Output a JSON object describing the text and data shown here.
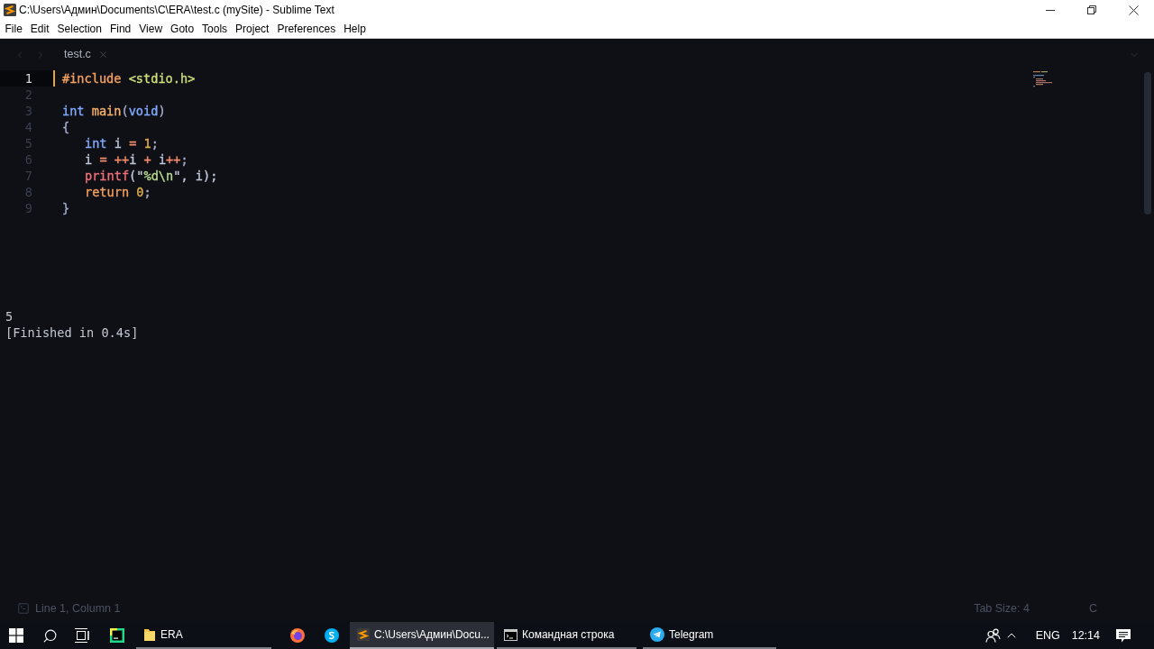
{
  "window": {
    "title": "C:\\Users\\Админ\\Documents\\C\\ERA\\test.c (mySite) - Sublime Text"
  },
  "menu": [
    "File",
    "Edit",
    "Selection",
    "Find",
    "View",
    "Goto",
    "Tools",
    "Project",
    "Preferences",
    "Help"
  ],
  "tabs": [
    {
      "label": "test.c",
      "selected": true
    }
  ],
  "editor": {
    "lines": [
      {
        "number": "1",
        "current": true,
        "tokens": [
          {
            "text": "#include ",
            "color": "#f5a05f"
          },
          {
            "text": "<stdio.h>",
            "color": "#d1df7a"
          }
        ]
      },
      {
        "number": "2",
        "current": false
      },
      {
        "number": "3",
        "current": false,
        "tokens": [
          {
            "text": "int ",
            "color": "#82aaff"
          },
          {
            "text": "main",
            "color": "#f8b26a"
          },
          {
            "text": "(",
            "color": "#a6accd"
          },
          {
            "text": "void",
            "color": "#82aaff"
          },
          {
            "text": ")",
            "color": "#a6accd"
          }
        ]
      },
      {
        "number": "4",
        "current": false,
        "tokens": [
          {
            "text": "{",
            "color": "#a6accd"
          }
        ],
        "children": [
          {
            "number": "5",
            "current": false,
            "tokens": [
              {
                "text": "int ",
                "color": "#82aaff"
              },
              {
                "text": "i ",
                "color": "#c0c6d8"
              },
              {
                "text": "= ",
                "color": "#f78c6c"
              },
              {
                "text": "1",
                "color": "#e2b04a"
              },
              {
                "text": ";",
                "color": "#a6accd"
              }
            ]
          },
          {
            "number": "6",
            "current": false,
            "tokens": [
              {
                "text": "i ",
                "color": "#c0c6d8"
              },
              {
                "text": "= ++",
                "color": "#f78c6c"
              },
              {
                "text": "i ",
                "color": "#c0c6d8"
              },
              {
                "text": "+ ",
                "color": "#f78c6c"
              },
              {
                "text": "i",
                "color": "#c0c6d8"
              },
              {
                "text": "++",
                "color": "#f78c6c"
              },
              {
                "text": ";",
                "color": "#a6accd"
              }
            ]
          },
          {
            "number": "7",
            "current": false,
            "tokens": [
              {
                "text": "printf",
                "color": "#f07178"
              },
              {
                "text": "(\"",
                "color": "#c0c6d8"
              },
              {
                "text": "%d\\n",
                "color": "#b9d98f"
              },
              {
                "text": "\", i);",
                "color": "#c0c6d8"
              }
            ]
          },
          {
            "number": "8",
            "current": false,
            "tokens": [
              {
                "text": "return ",
                "color": "#f5a05f"
              },
              {
                "text": "0",
                "color": "#e2b04a"
              },
              {
                "text": ";",
                "color": "#a6accd"
              }
            ]
          }
        ]
      },
      {
        "number": "9",
        "current": false,
        "tokens": [
          {
            "text": "}",
            "color": "#a6accd"
          }
        ]
      }
    ]
  },
  "output": [
    "5",
    "[Finished in 0.4s]"
  ],
  "status_bar": {
    "position": "Line 1, Column 1",
    "tab_size": "Tab Size: 4",
    "syntax": "C"
  },
  "taskbar": {
    "windows": [
      {
        "label": "ERA",
        "selected": false
      },
      {
        "label": "C:\\Users\\Админ\\Docu...",
        "selected": true
      },
      {
        "label": "Командная строка",
        "selected": false
      },
      {
        "label": "Telegram",
        "selected": false
      }
    ],
    "language": "ENG",
    "time": "12:14"
  }
}
